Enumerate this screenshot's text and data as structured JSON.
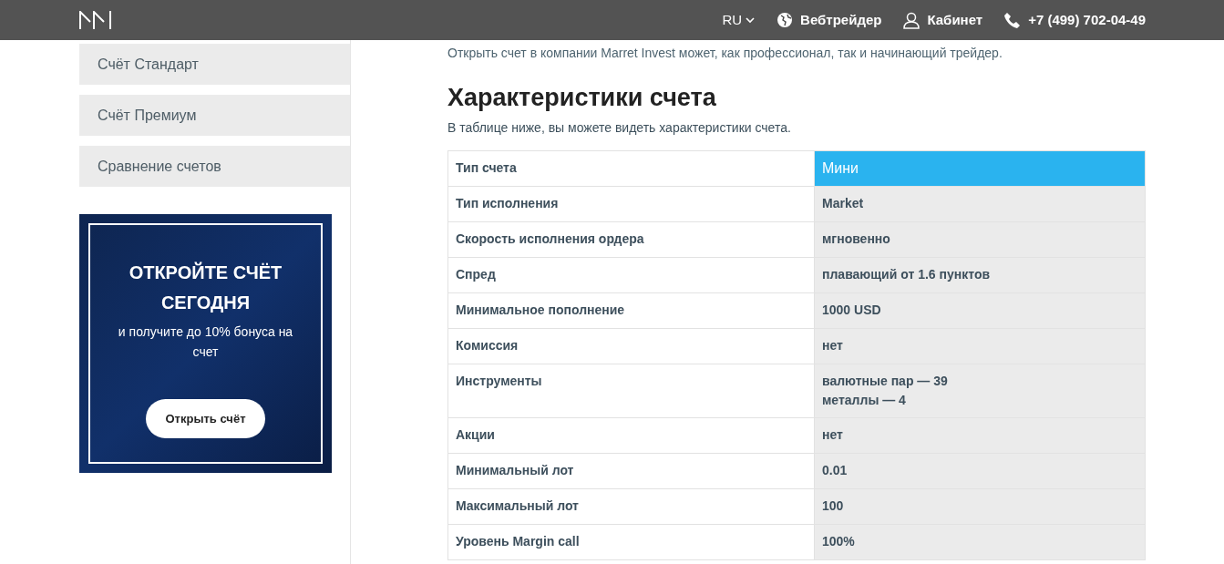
{
  "header": {
    "language": "RU",
    "links": [
      {
        "kind": "globe",
        "label": "Вебтрейдер"
      },
      {
        "kind": "user",
        "label": "Кабинет"
      },
      {
        "kind": "phone",
        "label": "+7 (499) 702-04-49"
      }
    ]
  },
  "sidebar": {
    "items": [
      {
        "label": "Счёт Стандарт"
      },
      {
        "label": "Счёт Премиум"
      },
      {
        "label": "Сравнение счетов"
      }
    ]
  },
  "promo": {
    "title": "ОТКРОЙТЕ СЧЁТ СЕГОДНЯ",
    "text": "и получите до 10% бонуса на счет",
    "button": "Открыть счёт"
  },
  "intro": "Открыть счет в компании Marret Invest может, как профессионал, так и начинающий трейдер.",
  "section": {
    "title": "Характеристики счета",
    "subtitle": "В таблице ниже, вы можете видеть характеристики счета."
  },
  "table": {
    "header": [
      "Тип счета",
      "Мини"
    ],
    "rows": [
      [
        "Тип исполнения",
        "Market"
      ],
      [
        "Скорость исполнения ордера",
        "мгновенно"
      ],
      [
        "Спред",
        "плавающий от 1.6 пунктов"
      ],
      [
        "Минимальное пополнение",
        "1000 USD"
      ],
      [
        "Комиссия",
        "нет"
      ],
      [
        "Инструменты",
        "валютные пар — 39\nметаллы — 4"
      ],
      [
        "Акции",
        "нет"
      ],
      [
        "Минимальный лот",
        "0.01"
      ],
      [
        "Максимальный лот",
        "100"
      ],
      [
        "Уровень Margin call",
        "100%"
      ]
    ]
  }
}
